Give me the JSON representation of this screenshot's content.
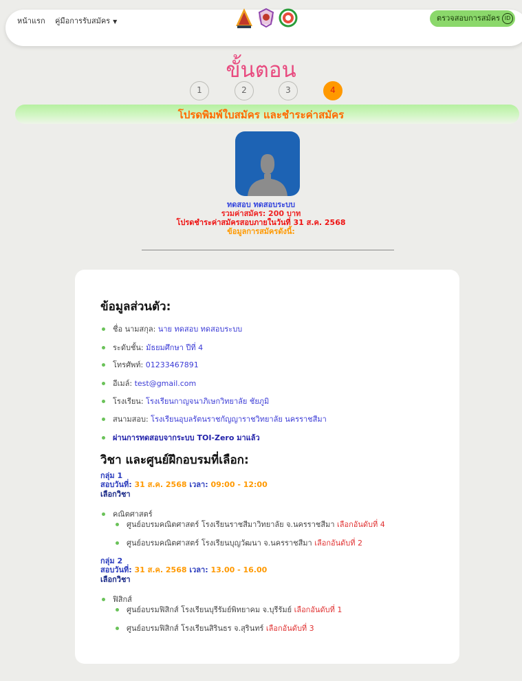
{
  "nav": {
    "home": "หน้าแรก",
    "manual": "คู่มือการรับสมัคร",
    "check_button": "ตรวจสอบการสมัคร"
  },
  "title": "ขั้นตอน",
  "steps": [
    "1",
    "2",
    "3",
    "4"
  ],
  "active_step": 4,
  "banner": "โปรดพิมพ์ใบสมัคร และชำระค่าสมัคร",
  "profile": {
    "name": "ทดสอบ ทดสอบระบบ",
    "fee": "รวมค่าสมัคร: 200 บาท",
    "deadline": "โปรดชำระค่าสมัครสอบภายในวันที่ 31 ส.ค. 2568",
    "info_heading": "ข้อมูลการสมัครดังนี้:"
  },
  "personal": {
    "title": "ข้อมูลส่วนตัว:",
    "items": [
      {
        "label": "ชื่อ นามสกุล:",
        "value": "นาย ทดสอบ ทดสอบระบบ"
      },
      {
        "label": "ระดับชั้น:",
        "value": "มัธยมศึกษา ปีที่ 4"
      },
      {
        "label": "โทรศัพท์:",
        "value": "01233467891"
      },
      {
        "label": "อีเมล์:",
        "value": "test@gmail.com"
      },
      {
        "label": "โรงเรียน:",
        "value": "โรงเรียนกาญจนาภิเษกวิทยาลัย ชัยภูมิ"
      },
      {
        "label": "สนามสอบ:",
        "value": "โรงเรียนอุบลรัตนราชกัญญาราชวิทยาลัย นครราชสีมา"
      }
    ],
    "passed": "ผ่านการทดสอบจากระบบ TOI-Zero มาแล้ว"
  },
  "subjects": {
    "title": "วิชา และศูนย์ฝึกอบรมที่เลือก:",
    "groups": [
      {
        "group": "กลุ่ม 1",
        "date_label": "สอบวันที่:",
        "date": "31 ส.ค. 2568",
        "time_label": "เวลา:",
        "time": "09:00 - 12:00",
        "choose": "เลือกวิชา",
        "subject": "คณิตศาสตร์",
        "centers": [
          {
            "name": "ศูนย์อบรมคณิตศาสตร์ โรงเรียนราชสีมาวิทยาลัย จ.นครราชสีมา",
            "rank": "เลือกอันดับที่ 4"
          },
          {
            "name": "ศูนย์อบรมคณิตศาสตร์ โรงเรียนบุญวัฒนา จ.นครราชสีมา",
            "rank": "เลือกอันดับที่ 2"
          }
        ]
      },
      {
        "group": "กลุ่ม 2",
        "date_label": "สอบวันที่:",
        "date": "31 ส.ค. 2568",
        "time_label": "เวลา:",
        "time": "13.00 - 16.00",
        "choose": "เลือกวิชา",
        "subject": "ฟิสิกส์",
        "centers": [
          {
            "name": "ศูนย์อบรมฟิสิกส์ โรงเรียนบุรีรัมย์พิทยาคม จ.บุรีรัมย์",
            "rank": "เลือกอันดับที่ 1"
          },
          {
            "name": "ศูนย์อบรมฟิสิกส์ โรงเรียนสิรินธร จ.สุรินทร์",
            "rank": "เลือกอันดับที่ 3"
          }
        ]
      }
    ]
  },
  "colors": {
    "title_pink": "#e84a7f",
    "accent_orange": "#ff9900",
    "green_button": "#8bd86b",
    "avatar_blue": "#1d63b4"
  }
}
